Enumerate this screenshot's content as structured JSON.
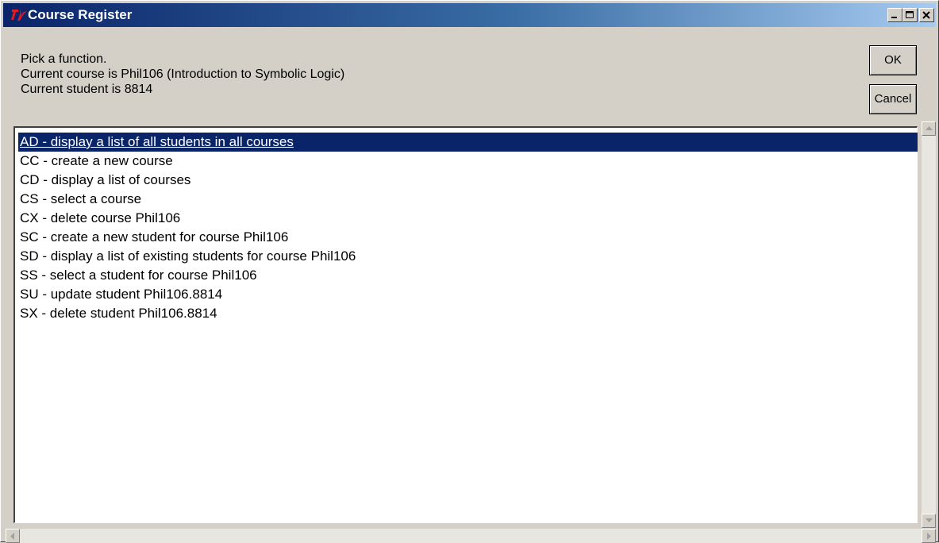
{
  "window": {
    "title": "Course Register",
    "controls": [
      "minimize-icon",
      "maximize-icon",
      "close-icon"
    ]
  },
  "message": {
    "line1": "Pick a function.",
    "line2": "Current course  is Phil106 (Introduction to Symbolic Logic)",
    "line3": "Current student is 8814"
  },
  "buttons": {
    "ok": "OK",
    "cancel": "Cancel"
  },
  "list": {
    "selected_index": 0,
    "items": [
      "AD - display a list of all students in all courses",
      "CC - create a new course",
      "CD - display a list of courses",
      "CS - select a course",
      "CX - delete course Phil106",
      "SC - create a new student for course Phil106",
      "SD - display a list of existing students for course Phil106",
      "SS - select a student for course Phil106",
      "SU - update student Phil106.8814",
      "SX - delete student Phil106.8814"
    ]
  },
  "colors": {
    "selection": "#0a246a",
    "titlebar_start": "#0a246a",
    "titlebar_end": "#a6caf0",
    "face": "#d4d0c8"
  }
}
